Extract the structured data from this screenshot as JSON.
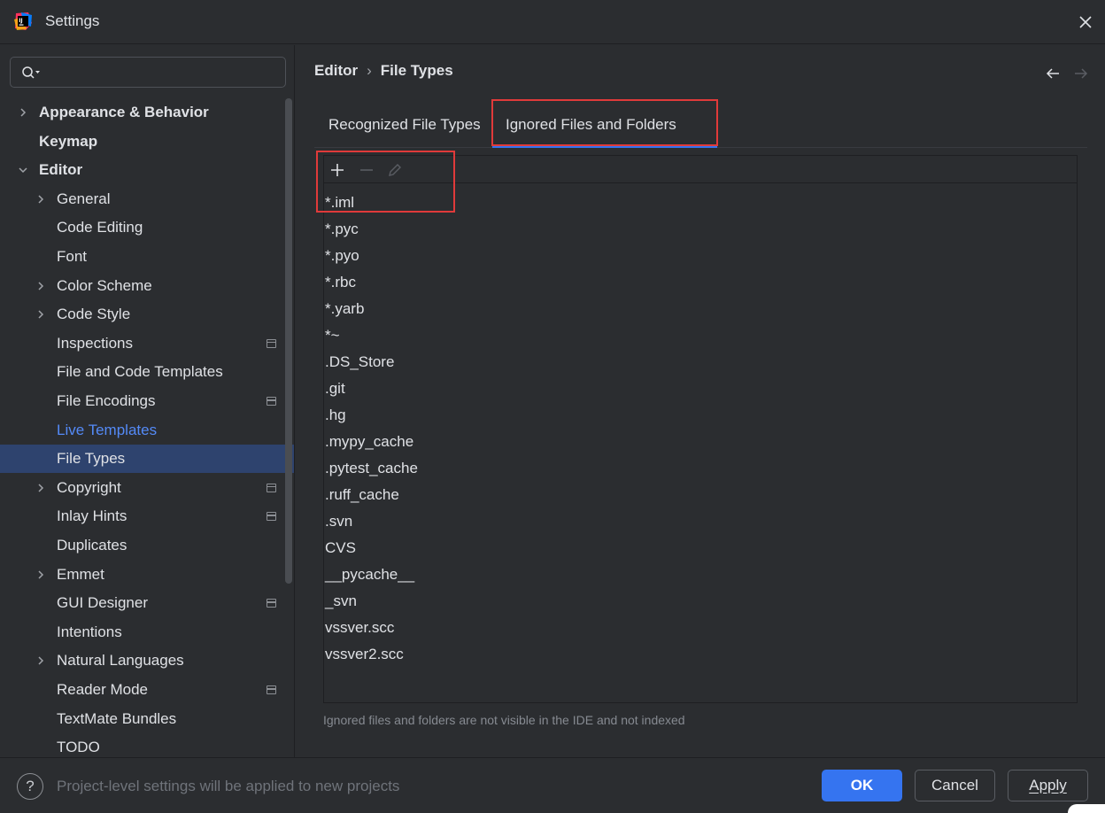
{
  "window": {
    "title": "Settings"
  },
  "search": {
    "placeholder": ""
  },
  "sidebar": {
    "items": [
      {
        "label": "Appearance & Behavior",
        "level": 0,
        "expandable": true,
        "expanded": false,
        "bold": true
      },
      {
        "label": "Keymap",
        "level": 0,
        "expandable": false,
        "bold": true
      },
      {
        "label": "Editor",
        "level": 0,
        "expandable": true,
        "expanded": true,
        "bold": true
      },
      {
        "label": "General",
        "level": 1,
        "expandable": true
      },
      {
        "label": "Code Editing",
        "level": 1
      },
      {
        "label": "Font",
        "level": 1
      },
      {
        "label": "Color Scheme",
        "level": 1,
        "expandable": true
      },
      {
        "label": "Code Style",
        "level": 1,
        "expandable": true
      },
      {
        "label": "Inspections",
        "level": 1,
        "project": true
      },
      {
        "label": "File and Code Templates",
        "level": 1
      },
      {
        "label": "File Encodings",
        "level": 1,
        "project": true
      },
      {
        "label": "Live Templates",
        "level": 1,
        "link": true
      },
      {
        "label": "File Types",
        "level": 1,
        "selected": true
      },
      {
        "label": "Copyright",
        "level": 1,
        "expandable": true,
        "project": true
      },
      {
        "label": "Inlay Hints",
        "level": 1,
        "project": true
      },
      {
        "label": "Duplicates",
        "level": 1
      },
      {
        "label": "Emmet",
        "level": 1,
        "expandable": true
      },
      {
        "label": "GUI Designer",
        "level": 1,
        "project": true
      },
      {
        "label": "Intentions",
        "level": 1
      },
      {
        "label": "Natural Languages",
        "level": 1,
        "expandable": true
      },
      {
        "label": "Reader Mode",
        "level": 1,
        "project": true
      },
      {
        "label": "TextMate Bundles",
        "level": 1
      },
      {
        "label": "TODO",
        "level": 1
      }
    ]
  },
  "breadcrumb": {
    "parent": "Editor",
    "separator": "›",
    "current": "File Types"
  },
  "tabs": [
    {
      "label": "Recognized File Types",
      "active": false
    },
    {
      "label": "Ignored Files and Folders",
      "active": true
    }
  ],
  "toolbar": {
    "add": "plus-icon",
    "remove": "minus-icon",
    "edit": "pencil-icon"
  },
  "ignored_items": [
    "*.iml",
    "*.pyc",
    "*.pyo",
    "*.rbc",
    "*.yarb",
    "*~",
    ".DS_Store",
    ".git",
    ".hg",
    ".mypy_cache",
    ".pytest_cache",
    ".ruff_cache",
    ".svn",
    "CVS",
    "__pycache__",
    "_svn",
    "vssver.scc",
    "vssver2.scc"
  ],
  "hint": "Ignored files and folders are not visible in the IDE and not indexed",
  "footer": {
    "help": "?",
    "note": "Project-level settings will be applied to new projects",
    "ok": "OK",
    "cancel": "Cancel",
    "apply": "Apply"
  },
  "colors": {
    "accent": "#3574f0",
    "selection": "#2e436e",
    "link": "#548af7",
    "highlight": "#e03a3a",
    "background": "#2b2d30"
  }
}
